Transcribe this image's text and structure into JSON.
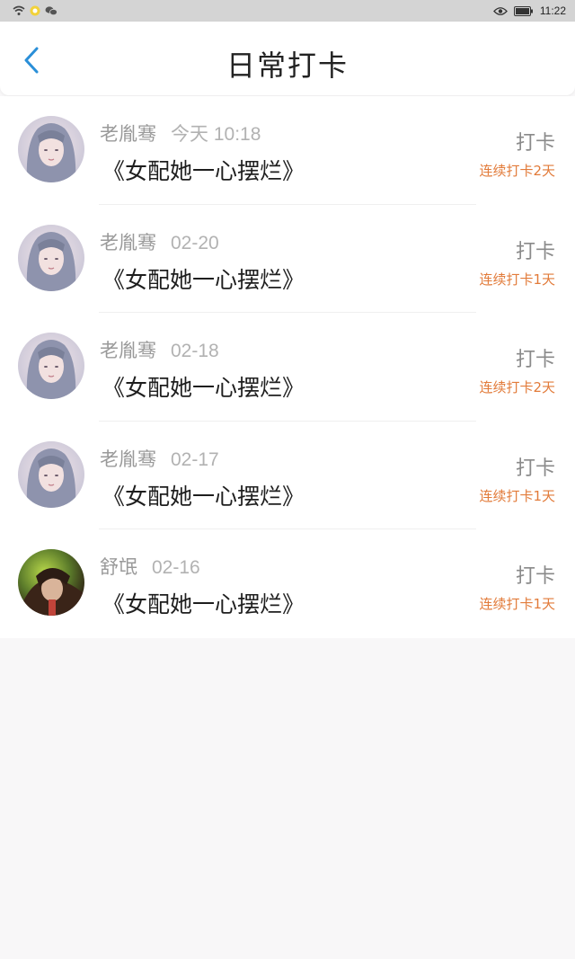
{
  "status_bar": {
    "time": "11:22"
  },
  "header": {
    "title": "日常打卡"
  },
  "items": [
    {
      "user": "老胤骞",
      "date": "今天 10:18",
      "book": "《女配她一心摆烂》",
      "action": "打卡",
      "streak": "连续打卡2天"
    },
    {
      "user": "老胤骞",
      "date": "02-20",
      "book": "《女配她一心摆烂》",
      "action": "打卡",
      "streak": "连续打卡1天"
    },
    {
      "user": "老胤骞",
      "date": "02-18",
      "book": "《女配她一心摆烂》",
      "action": "打卡",
      "streak": "连续打卡2天"
    },
    {
      "user": "老胤骞",
      "date": "02-17",
      "book": "《女配她一心摆烂》",
      "action": "打卡",
      "streak": "连续打卡1天"
    },
    {
      "user": "舒氓",
      "date": "02-16",
      "book": "《女配她一心摆烂》",
      "action": "打卡",
      "streak": "连续打卡1天"
    }
  ],
  "colors": {
    "accent": "#2a8fd8",
    "streak": "#e27b3a"
  }
}
